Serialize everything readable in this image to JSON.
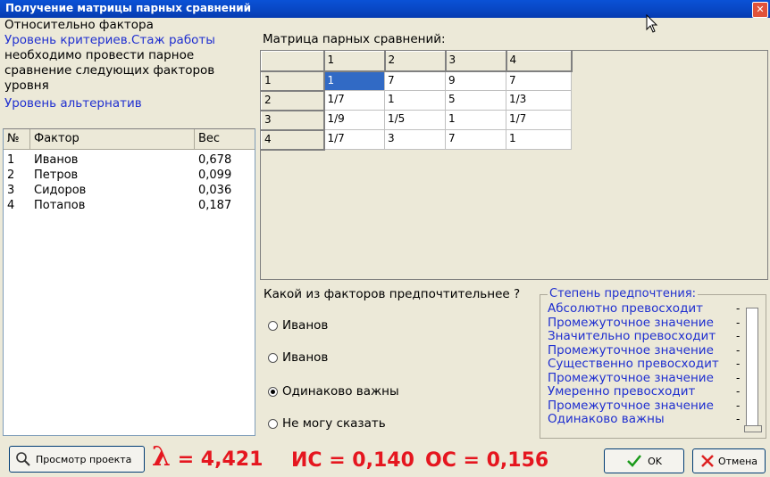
{
  "window": {
    "title": "Получение матрицы парных сравнений",
    "close_glyph": "✕"
  },
  "left": {
    "line1": "Относительно фактора",
    "line2": "Уровень критериев.Стаж работы",
    "line3": "необходимо провести парное",
    "line4": "сравнение следующих факторов",
    "line5": "уровня",
    "line6": "Уровень альтернатив",
    "columns": [
      "№",
      "Фактор",
      "Вес"
    ],
    "rows": [
      {
        "n": "1",
        "name": "Иванов",
        "weight": "0,678"
      },
      {
        "n": "2",
        "name": "Петров",
        "weight": "0,099"
      },
      {
        "n": "3",
        "name": "Сидоров",
        "weight": "0,036"
      },
      {
        "n": "4",
        "name": "Потапов",
        "weight": "0,187"
      }
    ]
  },
  "matrix": {
    "label": "Матрица парных сравнений:",
    "col_headers": [
      "1",
      "2",
      "3",
      "4"
    ],
    "row_headers": [
      "1",
      "2",
      "3",
      "4"
    ],
    "cells": [
      [
        "1",
        "7",
        "9",
        "7"
      ],
      [
        "1/7",
        "1",
        "5",
        "1/3"
      ],
      [
        "1/9",
        "1/5",
        "1",
        "1/7"
      ],
      [
        "1/7",
        "3",
        "7",
        "1"
      ]
    ]
  },
  "question": {
    "text": "Какой из факторов предпочтительнее ?",
    "options": [
      "Иванов",
      "Иванов",
      "Одинаково важны",
      "Не могу сказать"
    ],
    "selected_index": 2
  },
  "preference": {
    "title": "Степень предпочтения:",
    "items": [
      "Абсолютно превосходит",
      "Промежуточное значение",
      "Значительно превосходит",
      "Промежуточное значение",
      "Существенно превосходит",
      "Промежуточное значение",
      "Умеренно превосходит",
      "Промежуточное значение",
      "Одинаково важны"
    ],
    "tick": "-",
    "slider_value": "Одинаково важны"
  },
  "bottom": {
    "view_project": "Просмотр проекта",
    "lambda_symbol": "λ",
    "lambda_text": " = 4,421",
    "ic": "ИС = 0,140",
    "oc": "ОС = 0,156",
    "ok": "OK",
    "cancel": "Отмена"
  },
  "colors": {
    "accent": "#1f2fd0",
    "stat": "#e5161f",
    "title_bar": "#0a52d6",
    "selection": "#316ac5"
  }
}
